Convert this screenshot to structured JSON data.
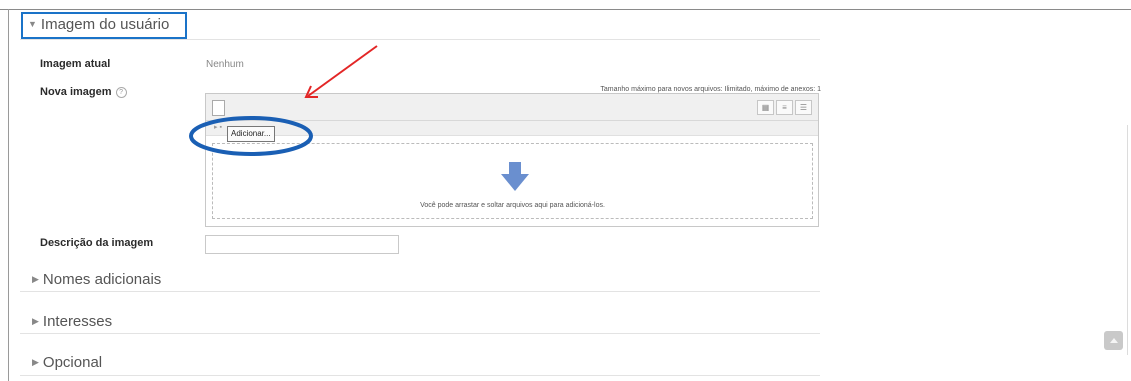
{
  "sections": {
    "user_image": {
      "title": "Imagem do usuário"
    },
    "additional_names": {
      "title": "Nomes adicionais"
    },
    "interests": {
      "title": "Interesses"
    },
    "optional": {
      "title": "Opcional"
    }
  },
  "current_image": {
    "label": "Imagem atual",
    "value": "Nenhum"
  },
  "new_image": {
    "label": "Nova imagem",
    "help_icon": "question-circle-icon",
    "max_size_text": "Tamanho máximo para novos arquivos: Ilimitado, máximo de anexos: 1",
    "add_button_label": "Adicionar...",
    "dropzone_text": "Você pode arrastar e soltar arquivos aqui para adicioná-los.",
    "view_icons": [
      "icon-view-icon",
      "list-view-icon",
      "tree-view-icon"
    ]
  },
  "image_description": {
    "label": "Descrição da imagem",
    "value": ""
  },
  "annotation_colors": {
    "highlight_box": "#1a73c8",
    "circle": "#1a5fb4",
    "arrow": "#e32626"
  },
  "accent_colors": {
    "dropzone_arrow": "#6a8fcf"
  }
}
